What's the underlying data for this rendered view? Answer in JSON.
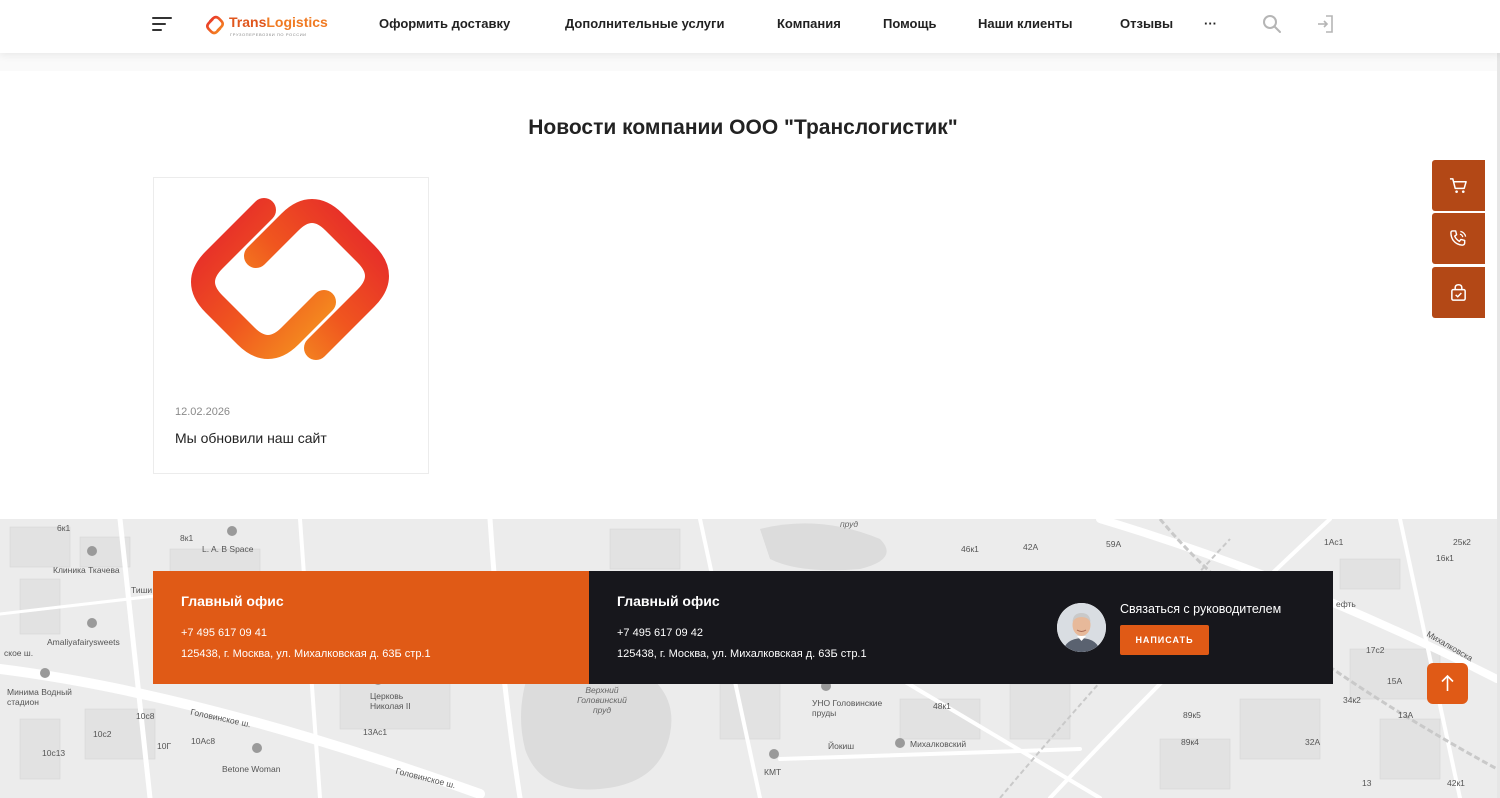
{
  "header": {
    "logo": {
      "brand_part1": "Trans",
      "brand_part2": "Logistics",
      "tagline": "ГРУЗОПЕРЕВОЗКИ ПО РОССИИ"
    },
    "nav": [
      {
        "label": "Оформить доставку"
      },
      {
        "label": "Дополнительные услуги"
      },
      {
        "label": "Компания"
      },
      {
        "label": "Помощь"
      },
      {
        "label": "Наши клиенты"
      },
      {
        "label": "Отзывы"
      },
      {
        "label": "···"
      }
    ],
    "icons": [
      "menu-icon",
      "search-icon",
      "login-icon"
    ]
  },
  "main": {
    "title": "Новости компании ООО \"Транслогистик\"",
    "news": [
      {
        "date": "12.02.2026",
        "title": "Мы обновили наш сайт"
      }
    ]
  },
  "side_buttons": [
    "cart-icon",
    "phone-call-icon",
    "lock-bag-icon"
  ],
  "map": {
    "labels": [
      "6к1",
      "8к1",
      "L. A. B Space",
      "Клиника Ткачева",
      "Тиши",
      "Amaliyafairysweets",
      "ское ш.",
      "Минима Водный стадион",
      "Головинское ш.",
      "Церковь Николая II",
      "Верхний Головинский пруд",
      "УНО Головинские пруды",
      "Йокиш",
      "Михалковский",
      "КМТ",
      "Betone Woman",
      "Головинское ш.",
      "10с8",
      "10с2",
      "10Г",
      "10Ac8",
      "13Ac1",
      "10с13",
      "пруд",
      "46к1",
      "42А",
      "59А",
      "1Ас1",
      "25к2",
      "16к1",
      "Михалковска",
      "ефть",
      "48к1",
      "17с2",
      "15А",
      "34к2",
      "89к5",
      "89к4",
      "32А",
      "13А",
      "42к1",
      "13"
    ]
  },
  "footer": {
    "office_left": {
      "title": "Главный офис",
      "phone": "+7 495 617 09 41",
      "address": "125438, г. Москва, ул. Михалковская д. 63Б стр.1"
    },
    "office_right": {
      "title": "Главный офис",
      "phone": "+7 495 617 09 42",
      "address": "125438, г. Москва, ул. Михалковская д. 63Б стр.1"
    },
    "contact_label": "Связаться с руководителем",
    "write_button": "НАПИСАТЬ"
  },
  "colors": {
    "accent": "#e05a16",
    "side_button": "#b34816",
    "dark_panel": "#17171c"
  }
}
